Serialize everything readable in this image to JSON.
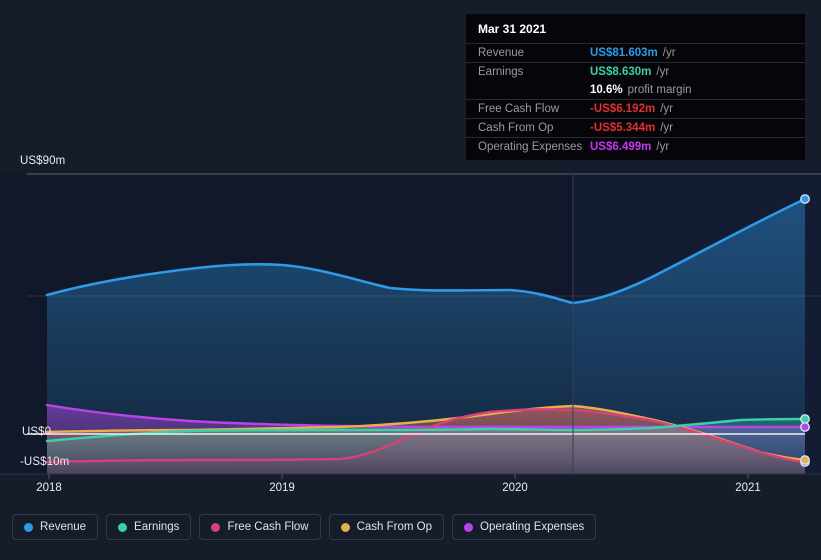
{
  "tooltip": {
    "date": "Mar 31 2021",
    "rows": [
      {
        "label": "Revenue",
        "value": "US$81.603m",
        "unit": "/yr",
        "color": "#2f9ae8"
      },
      {
        "label": "Earnings",
        "value": "US$8.630m",
        "unit": "/yr",
        "color": "#3ad0ac"
      },
      {
        "label": "",
        "value": "10.6%",
        "unit": "profit margin",
        "color": "#ffffff"
      },
      {
        "label": "Free Cash Flow",
        "value": "-US$6.192m",
        "unit": "/yr",
        "color": "#e03030"
      },
      {
        "label": "Cash From Op",
        "value": "-US$5.344m",
        "unit": "/yr",
        "color": "#e03030"
      },
      {
        "label": "Operating Expenses",
        "value": "US$6.499m",
        "unit": "/yr",
        "color": "#c238f0"
      }
    ]
  },
  "axes": {
    "y_top": "US$90m",
    "y_zero": "US$0",
    "y_negative": "-US$10m",
    "x_labels": [
      "2018",
      "2019",
      "2020",
      "2021"
    ]
  },
  "legend": [
    {
      "label": "Revenue",
      "color": "#2f9ae8"
    },
    {
      "label": "Earnings",
      "color": "#3ad0ac"
    },
    {
      "label": "Free Cash Flow",
      "color": "#d8407a"
    },
    {
      "label": "Cash From Op",
      "color": "#e8ae4e"
    },
    {
      "label": "Operating Expenses",
      "color": "#b845e8"
    }
  ],
  "chart_data": {
    "type": "area",
    "title": "",
    "xlabel": "",
    "ylabel": "US$",
    "ylim": [
      -10,
      90
    ],
    "grid": true,
    "legend_position": "bottom",
    "x": [
      "2018",
      "2018.25",
      "2018.5",
      "2018.75",
      "2019",
      "2019.25",
      "2019.5",
      "2019.75",
      "2020",
      "2020.25",
      "2020.5",
      "2020.75",
      "2021"
    ],
    "series": [
      {
        "name": "Revenue",
        "color": "#2f9ae8",
        "values": [
          40.5,
          44.0,
          47.5,
          50.2,
          51.5,
          50.0,
          45.8,
          44.5,
          44.5,
          42.0,
          45.5,
          56.0,
          81.603
        ]
      },
      {
        "name": "Earnings",
        "color": "#3ad0ac",
        "values": [
          -2.0,
          -0.9,
          0.2,
          0.9,
          1.2,
          1.0,
          0.7,
          0.8,
          1.0,
          0.9,
          0.4,
          3.4,
          8.63
        ]
      },
      {
        "name": "Free Cash Flow",
        "color": "#d8407a",
        "values": [
          -9.0,
          -8.6,
          -8.4,
          -8.4,
          -8.3,
          -7.6,
          -4.7,
          -1.2,
          0.9,
          2.6,
          1.4,
          -1.5,
          -6.192
        ]
      },
      {
        "name": "Cash From Op",
        "color": "#e8ae4e",
        "values": [
          0.3,
          0.3,
          0.3,
          0.4,
          0.6,
          0.9,
          1.2,
          1.4,
          2.0,
          4.0,
          3.3,
          0.6,
          -5.344
        ]
      },
      {
        "name": "Operating Expenses",
        "color": "#b845e8",
        "values": [
          7.3,
          6.4,
          5.5,
          4.7,
          4.2,
          3.9,
          3.7,
          3.5,
          3.3,
          3.1,
          2.9,
          2.8,
          6.499
        ]
      }
    ],
    "annotation_line": {
      "label": "Mar 31 2021",
      "x": "2020.25"
    }
  }
}
